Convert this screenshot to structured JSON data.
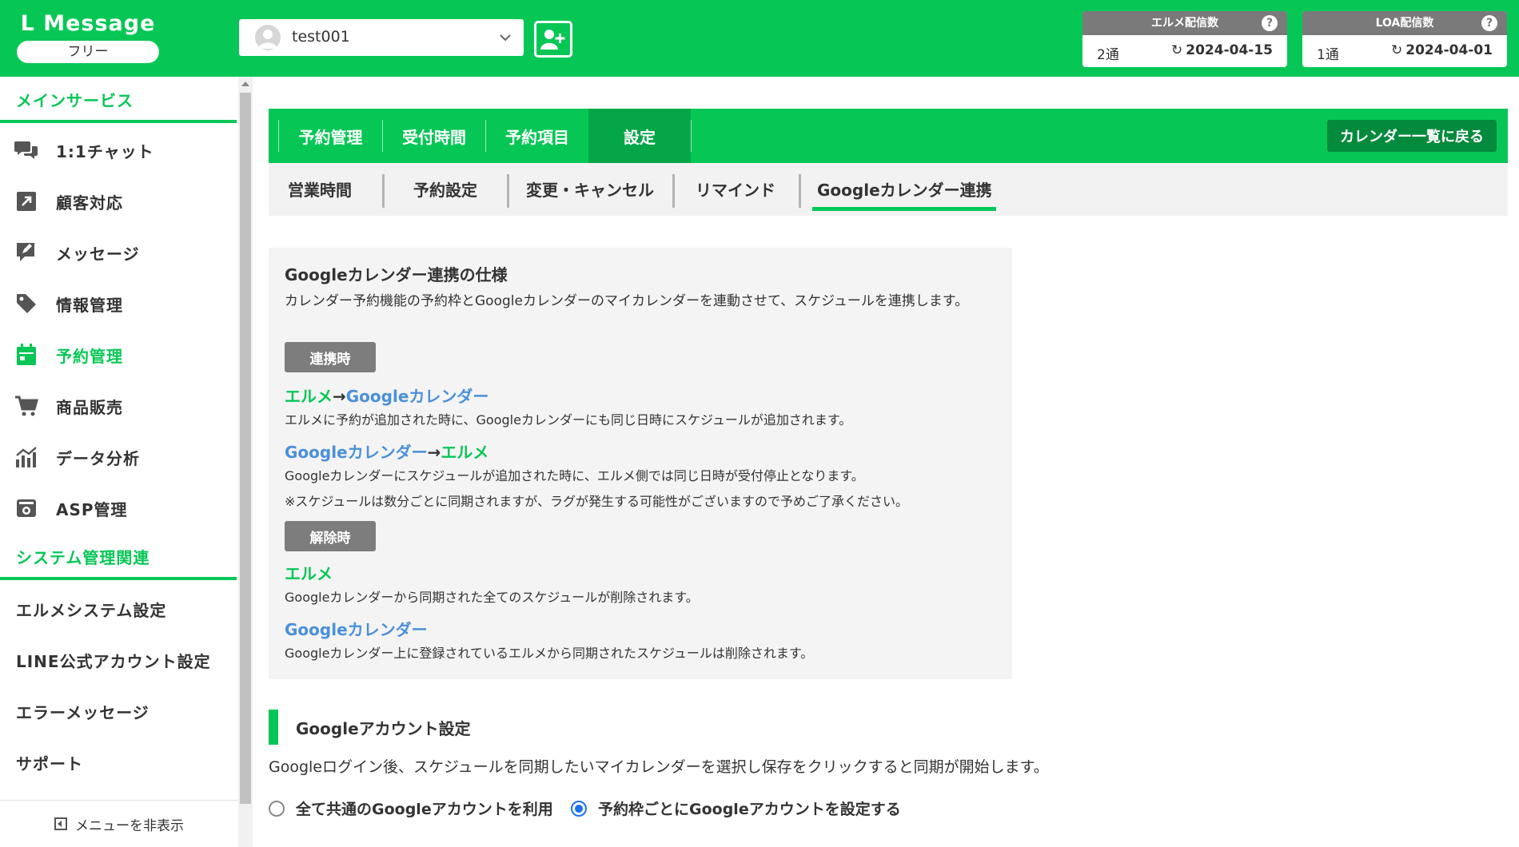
{
  "colors": {
    "brand": "#06c755",
    "brand_dark": "#048a3d",
    "link_blue": "#4a90d9",
    "badge_gray": "#7d7d7d"
  },
  "header": {
    "logo_title": "L Message",
    "plan": "フリー",
    "account": {
      "name": "test001",
      "icon": "user-avatar-icon"
    },
    "add_user_icon": "add-user-icon",
    "stats": [
      {
        "title": "エルメ配信数",
        "count": "2通",
        "date": "2024-04-15"
      },
      {
        "title": "LOA配信数",
        "count": "1通",
        "date": "2024-04-01"
      }
    ]
  },
  "sidebar": {
    "section_main": "メインサービス",
    "items": [
      {
        "label": "1:1チャット",
        "icon": "chat-icon"
      },
      {
        "label": "顧客対応",
        "icon": "external-link-icon"
      },
      {
        "label": "メッセージ",
        "icon": "edit-message-icon"
      },
      {
        "label": "情報管理",
        "icon": "tag-icon"
      },
      {
        "label": "予約管理",
        "icon": "calendar-icon"
      },
      {
        "label": "商品販売",
        "icon": "cart-icon"
      },
      {
        "label": "データ分析",
        "icon": "chart-icon"
      },
      {
        "label": "ASP管理",
        "icon": "asp-icon"
      }
    ],
    "section_system": "システム管理関連",
    "system_items": [
      "エルメシステム設定",
      "LINE公式アカウント設定",
      "エラーメッセージ",
      "サポート"
    ],
    "hide_menu": "メニューを非表示"
  },
  "tabs": {
    "items": [
      "予約管理",
      "受付時間",
      "予約項目",
      "設定"
    ],
    "back_button": "カレンダー一覧に戻る"
  },
  "subtabs": {
    "items": [
      "営業時間",
      "予約設定",
      "変更・キャンセル",
      "リマインド",
      "Googleカレンダー連携"
    ]
  },
  "spec": {
    "title": "Googleカレンダー連携の仕様",
    "description": "カレンダー予約機能の予約枠とGoogleカレンダーのマイカレンダーを連動させて、スケジュールを連携します。",
    "linking_badge": "連携時",
    "l2g_from": "エルメ",
    "arrow": "→",
    "l2g_to": "Googleカレンダー",
    "l2g_text": "エルメに予約が追加された時に、Googleカレンダーにも同じ日時にスケジュールが追加されます。",
    "g2l_from": "Googleカレンダー",
    "g2l_to": "エルメ",
    "g2l_text": "Googleカレンダーにスケジュールが追加された時に、エルメ側では同じ日時が受付停止となります。",
    "sync_note": "※スケジュールは数分ごとに同期されますが、ラグが発生する可能性がございますので予めご了承ください。",
    "unlink_badge": "解除時",
    "unlink_lme": "エルメ",
    "unlink_lme_text": "Googleカレンダーから同期された全てのスケジュールが削除されます。",
    "unlink_google": "Googleカレンダー",
    "unlink_google_text": "Googleカレンダー上に登録されているエルメから同期されたスケジュールは削除されます。"
  },
  "google_account": {
    "title": "Googleアカウント設定",
    "description": "Googleログイン後、スケジュールを同期したいマイカレンダーを選択し保存をクリックすると同期が開始します。",
    "options": [
      {
        "label": "全て共通のGoogleアカウントを利用",
        "checked": false
      },
      {
        "label": "予約枠ごとにGoogleアカウントを設定する",
        "checked": true
      }
    ]
  }
}
